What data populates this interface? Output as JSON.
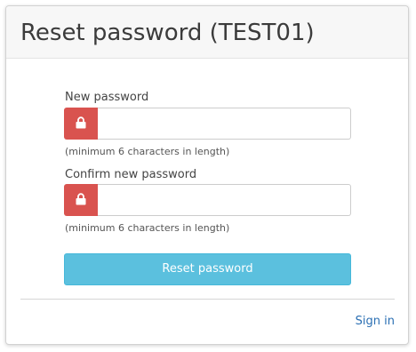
{
  "header": {
    "title": "Reset password (TEST01)"
  },
  "form": {
    "new_password": {
      "label": "New password",
      "value": "",
      "placeholder": "",
      "icon": "lock-icon",
      "help": "(minimum 6 characters in length)"
    },
    "confirm_password": {
      "label": "Confirm new password",
      "value": "",
      "placeholder": "",
      "icon": "lock-icon",
      "help": "(minimum 6 characters in length)"
    },
    "submit_label": "Reset password"
  },
  "footer": {
    "signin_label": "Sign in"
  },
  "colors": {
    "addon_red": "#d9534f",
    "button_blue": "#5bc0de",
    "link_blue": "#2a6fb3"
  }
}
